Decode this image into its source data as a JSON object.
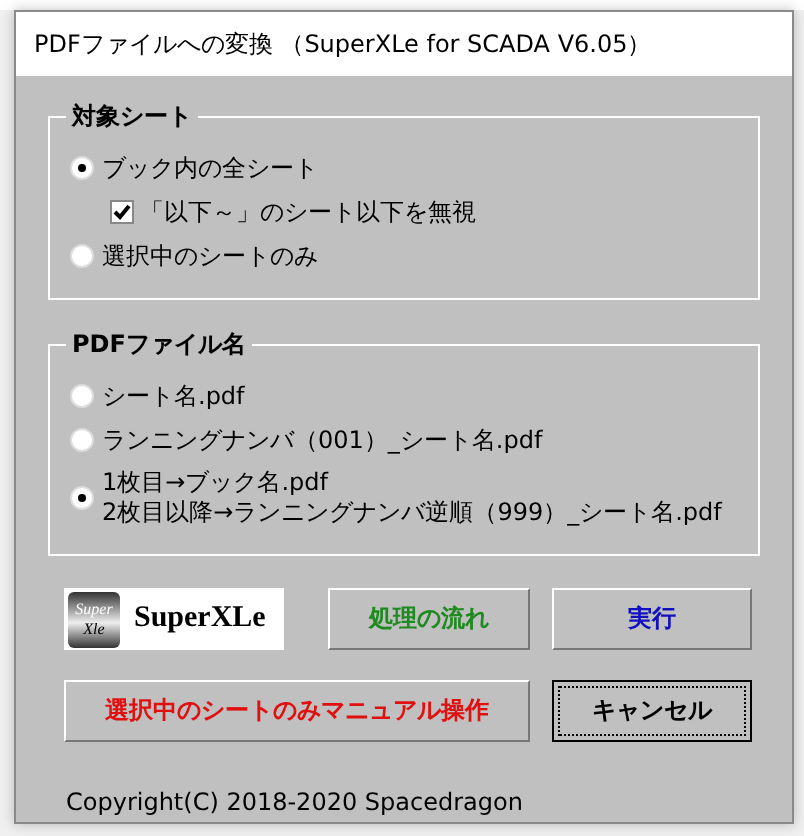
{
  "window": {
    "title": "PDFファイルへの変換 （SuperXLe for SCADA V6.05）"
  },
  "target_group": {
    "title": "対象シート",
    "options": [
      {
        "label": "ブック内の全シート",
        "selected": true,
        "checkbox": {
          "label": "「以下～」のシート以下を無視",
          "checked": true
        }
      },
      {
        "label": "選択中のシートのみ",
        "selected": false
      }
    ]
  },
  "filename_group": {
    "title": "PDFファイル名",
    "options": [
      {
        "lines": [
          "シート名.pdf"
        ],
        "selected": false
      },
      {
        "lines": [
          "ランニングナンバ（001）_シート名.pdf"
        ],
        "selected": false
      },
      {
        "lines": [
          "1枚目→ブック名.pdf",
          "2枚目以降→ランニングナンバ逆順（999）_シート名.pdf"
        ],
        "selected": true
      }
    ]
  },
  "logo": {
    "badge_top": "Super",
    "badge_bottom": "Xle",
    "name": "SuperXLe"
  },
  "buttons": [
    {
      "label": "処理の流れ",
      "color": "#1f8a1f",
      "focused": false
    },
    {
      "label": "実行",
      "color": "#1010c0",
      "focused": false
    },
    {
      "label": "選択中のシートのみマニュアル操作",
      "color": "#e01010",
      "focused": false
    },
    {
      "label": "キャンセル",
      "color": "#000000",
      "focused": true
    }
  ],
  "copyright": "Copyright(C) 2018-2020 Spacedragon"
}
